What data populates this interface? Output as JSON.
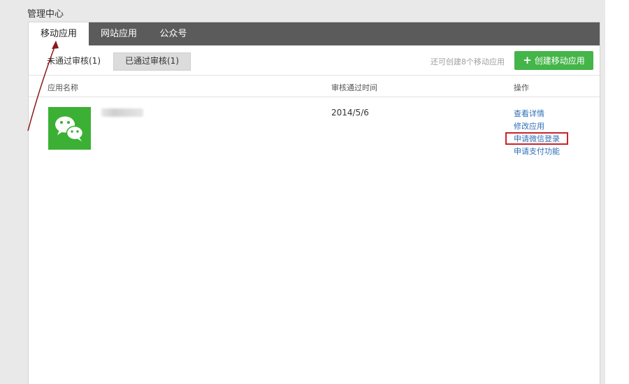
{
  "page": {
    "title": "管理中心"
  },
  "tabs": [
    {
      "label": "移动应用",
      "active": true
    },
    {
      "label": "网站应用",
      "active": false
    },
    {
      "label": "公众号",
      "active": false
    }
  ],
  "subtabs": {
    "pending": "未通过审核(1)",
    "approved": "已通过审核(1)"
  },
  "toolbar": {
    "quota_text": "还可创建8个移动应用",
    "create_label": "创建移动应用",
    "create_icon": "plus-icon"
  },
  "table": {
    "headers": {
      "name": "应用名称",
      "time": "审核通过时间",
      "ops": "操作"
    },
    "rows": [
      {
        "icon": "wechat-icon",
        "time": "2014/5/6",
        "ops": [
          "查看详情",
          "修改应用",
          "申请微信登录",
          "申请支付功能"
        ]
      }
    ]
  },
  "colors": {
    "tab_bar": "#5b5b5b",
    "primary_green": "#44b549",
    "link_blue": "#2c6fb6",
    "annotation_red": "#c9232c",
    "wechat_green": "#3cb034"
  }
}
